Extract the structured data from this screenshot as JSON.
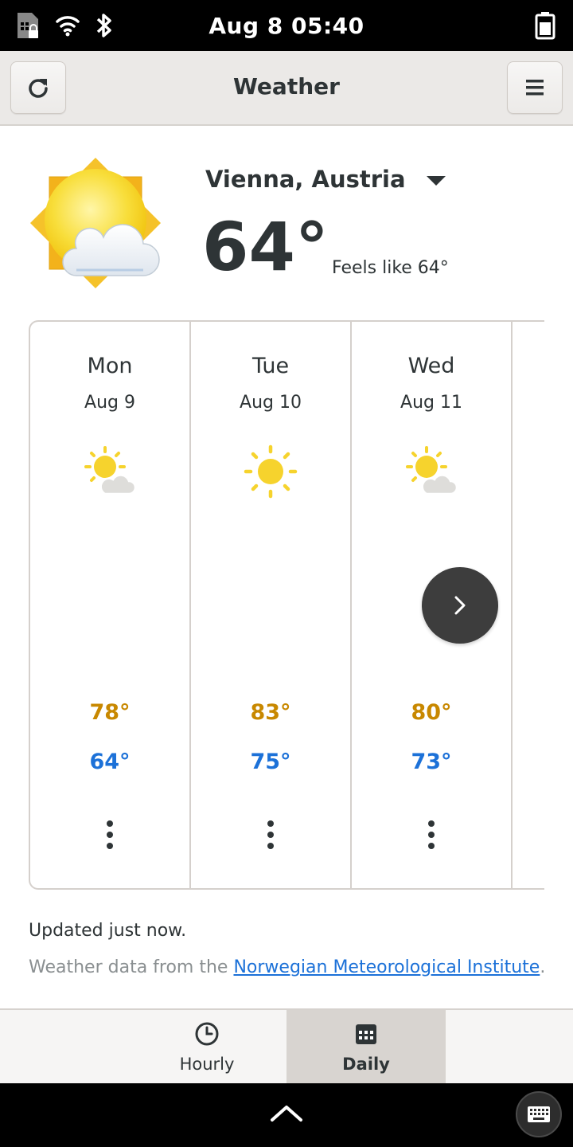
{
  "status_bar": {
    "time": "Aug 8  05:40",
    "icons": [
      "sim-locked-icon",
      "wifi-icon",
      "bluetooth-icon",
      "battery-icon"
    ]
  },
  "header": {
    "title": "Weather",
    "refresh_icon": "refresh-icon",
    "menu_icon": "hamburger-menu-icon"
  },
  "current": {
    "location": "Vienna, Austria",
    "temperature": "64°",
    "feels_like": "Feels like 64°",
    "condition_icon": "sun-with-cloud-icon"
  },
  "forecast": {
    "days": [
      {
        "day": "Mon",
        "date": "Aug  9",
        "icon": "partly-cloudy-icon",
        "high": "78°",
        "low": "64°"
      },
      {
        "day": "Tue",
        "date": "Aug 10",
        "icon": "sunny-icon",
        "high": "83°",
        "low": "75°"
      },
      {
        "day": "Wed",
        "date": "Aug 11",
        "icon": "partly-cloudy-icon",
        "high": "80°",
        "low": "73°"
      }
    ],
    "next_icon": "chevron-right-icon"
  },
  "footer": {
    "updated": "Updated just now.",
    "attribution_prefix": "Weather data from the ",
    "attribution_link": "Norwegian Meteorological Institute",
    "attribution_suffix": "."
  },
  "view_switcher": {
    "hourly_label": "Hourly",
    "daily_label": "Daily",
    "active": "Daily"
  },
  "colors": {
    "high_temp": "#c88800",
    "low_temp": "#1c71d8",
    "link": "#1c71d8",
    "header_bg": "#ebe9e7"
  }
}
